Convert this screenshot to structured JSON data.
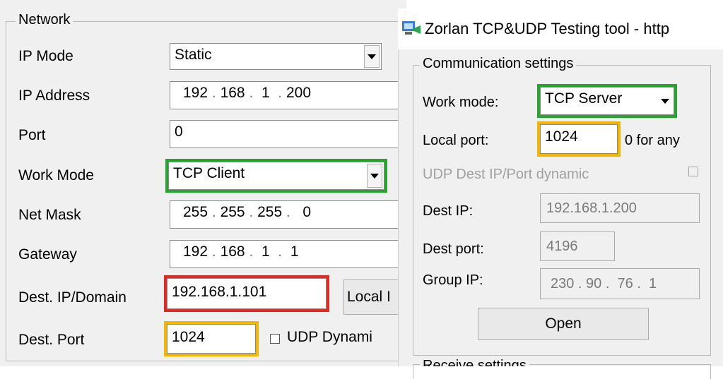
{
  "network": {
    "group_title": "Network",
    "ip_mode": {
      "label": "IP Mode",
      "value": "Static"
    },
    "ip_address": {
      "label": "IP Address",
      "parts": [
        "192",
        "168",
        "1",
        "200"
      ]
    },
    "port": {
      "label": "Port",
      "value": "0"
    },
    "work_mode": {
      "label": "Work Mode",
      "value": "TCP Client"
    },
    "net_mask": {
      "label": "Net Mask",
      "parts": [
        "255",
        "255",
        "255",
        "0"
      ]
    },
    "gateway": {
      "label": "Gateway",
      "parts": [
        "192",
        "168",
        "1",
        "1"
      ]
    },
    "dest_ip": {
      "label": "Dest. IP/Domain",
      "value": "192.168.1.101"
    },
    "local_button": "Local I",
    "dest_port": {
      "label": "Dest. Port",
      "value": "1024"
    },
    "udp_dynamic_label": "UDP Dynami"
  },
  "tool": {
    "title": "Zorlan TCP&UDP Testing tool - http",
    "comm_group_title": "Communication settings",
    "work_mode": {
      "label": "Work mode:",
      "value": "TCP Server"
    },
    "local_port": {
      "label": "Local port:",
      "value": "1024",
      "hint": "0 for any"
    },
    "udp_dest_dynamic": "UDP Dest IP/Port dynamic",
    "dest_ip": {
      "label": "Dest IP:",
      "value": "192.168.1.200"
    },
    "dest_port": {
      "label": "Dest port:",
      "value": "4196"
    },
    "group_ip": {
      "label": "Group IP:",
      "parts": [
        "230",
        "90",
        "76",
        "1"
      ]
    },
    "open_button": "Open",
    "receive_group_title": "Receive settings"
  },
  "colors": {
    "highlight_green": "#27a32f",
    "highlight_red": "#e02a22",
    "highlight_yellow": "#f2b500"
  }
}
